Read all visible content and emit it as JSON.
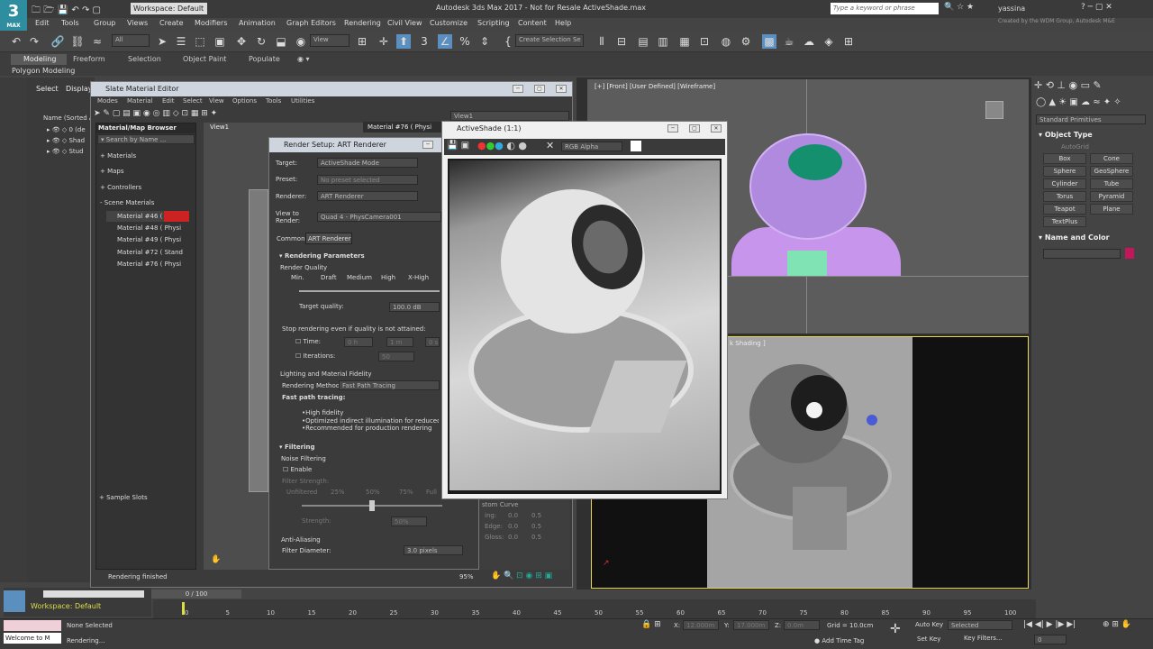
{
  "app": {
    "title": "Autodesk 3ds Max 2017 - Not for Resale   ActiveShade.max",
    "workspace": "Workspace: Default",
    "search_placeholder": "Type a keyword or phrase",
    "user": "yassina",
    "credit": "Created by the WDM Group, Autodesk M&E",
    "logo": "3",
    "logo_sub": "MAX"
  },
  "menu": [
    "Edit",
    "Tools",
    "Group",
    "Views",
    "Create",
    "Modifiers",
    "Animation",
    "Graph Editors",
    "Rendering",
    "Civil View",
    "Customize",
    "Scripting",
    "Content",
    "Help"
  ],
  "toolbar": {
    "filter_all": "All",
    "view": "View",
    "create_selection": "Create Selection Se"
  },
  "ribbon": {
    "tabs": [
      "Modeling",
      "Freeform",
      "Selection",
      "Object Paint",
      "Populate"
    ],
    "sub": "Polygon Modeling"
  },
  "scene_explorer": {
    "tabs": [
      "Select",
      "Display"
    ],
    "header": "Name (Sorted A",
    "items": [
      "0 (de",
      "Shad",
      "Stud"
    ]
  },
  "slate": {
    "title": "Slate Material Editor",
    "menu": [
      "Modes",
      "Material",
      "Edit",
      "Select",
      "View",
      "Options",
      "Tools",
      "Utilities"
    ],
    "browser_title": "Material/Map Browser",
    "search": "Search by Name ...",
    "groups": [
      "+ Materials",
      "+ Maps",
      "+ Controllers",
      "- Scene Materials"
    ],
    "materials": [
      "Material #46  ( Physi",
      "Material #48  ( Physi",
      "Material #49  ( Physi",
      "Material #72  ( Stand",
      "Material #76  ( Physi"
    ],
    "sample_slots": "+ Sample Slots",
    "view_tab": "View1",
    "view_dropdown": "View1",
    "node_header": "Material #76  ( Physi",
    "status": "Rendering finished",
    "zoom": "95%"
  },
  "render_setup": {
    "title": "Render Setup: ART Renderer",
    "target_label": "Target:",
    "target": "ActiveShade Mode",
    "preset_label": "Preset:",
    "preset": "No preset selected",
    "renderer_label": "Renderer:",
    "renderer": "ART Renderer",
    "view_label": "View to Render:",
    "view": "Quad 4 - PhysCamera001",
    "tabs": [
      "Common",
      "ART Renderer"
    ],
    "section1": "Rendering Parameters",
    "render_quality": "Render Quality",
    "quality_levels": [
      "Min.",
      "Draft",
      "Medium",
      "High",
      "X-High"
    ],
    "target_quality_label": "Target quality:",
    "target_quality": "100.0 dB",
    "stop_label": "Stop rendering even if quality is not attained:",
    "time_label": "Time:",
    "time_vals": [
      "0 h",
      "1 m",
      "0 s"
    ],
    "iterations_label": "Iterations:",
    "iterations": "50",
    "fidelity": "Lighting and Material Fidelity",
    "method_label": "Rendering Method:",
    "method": "Fast Path Tracing",
    "fast_title": "Fast path tracing:",
    "bullets": [
      "•High fidelity",
      "•Optimized indirect illumination for reduced noise",
      "•Recommended for production rendering"
    ],
    "filtering": "Filtering",
    "noise": "Noise Filtering",
    "enable": "Enable",
    "filter_strength": "Filter Strength:",
    "strength_ticks": [
      "Unfiltered",
      "25%",
      "50%",
      "75%",
      "Full"
    ],
    "strength_label": "Strength:",
    "strength": "50%",
    "anti": "Anti-Aliasing",
    "diam_label": "Filter Diameter:",
    "diam": "3.0 pixels",
    "curve": "stom Curve",
    "curve_rows": [
      [
        "ing:",
        "0.0"
      ],
      [
        "Edge:",
        "0.0"
      ],
      [
        "Gloss:",
        "0.0"
      ]
    ],
    "curve_vals": [
      "0.5",
      "0.5",
      "0.5"
    ]
  },
  "activeshade": {
    "title": "ActiveShade (1:1)",
    "channel": "RGB Alpha"
  },
  "viewports": {
    "front": "[+] [Front] [User Defined] [Wireframe]",
    "persp": "k Shading ]"
  },
  "command_panel": {
    "dropdown": "Standard Primitives",
    "object_type": "Object Type",
    "autogrid": "AutoGrid",
    "buttons": [
      "Box",
      "Cone",
      "Sphere",
      "GeoSphere",
      "Cylinder",
      "Tube",
      "Torus",
      "Pyramid",
      "Teapot",
      "Plane",
      "TextPlus"
    ],
    "name_color": "Name and Color",
    "color": "#c2185b"
  },
  "timeline": {
    "frame": "0 / 100",
    "ticks": [
      "0",
      "5",
      "10",
      "15",
      "20",
      "25",
      "30",
      "35",
      "40",
      "45",
      "50",
      "55",
      "60",
      "65",
      "70",
      "75",
      "80",
      "85",
      "90",
      "95",
      "100"
    ]
  },
  "statusbar": {
    "workspace": "Workspace: Default",
    "welcome": "Welcome to M",
    "none_selected": "None Selected",
    "rendering": "Rendering...",
    "x_label": "X:",
    "x": "12.000m",
    "y_label": "Y:",
    "y": "17.000m",
    "z_label": "Z:",
    "z": "0.0m",
    "grid": "Grid = 10.0cm",
    "add_time_tag": "Add Time Tag",
    "auto_key": "Auto Key",
    "set_key": "Set Key",
    "selected": "Selected",
    "key_filters": "Key Filters...",
    "frame_val": "0"
  }
}
